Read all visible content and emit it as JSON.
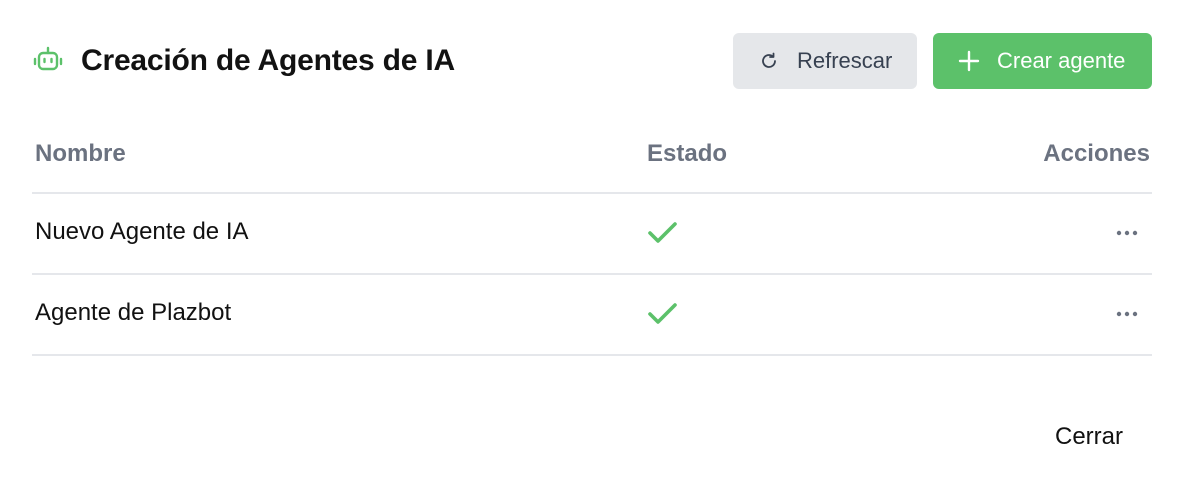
{
  "header": {
    "title": "Creación de Agentes de IA",
    "icon": "robot-icon",
    "refresh_label": "Refrescar",
    "refresh_icon": "refresh-icon",
    "create_label": "Crear agente",
    "create_icon": "plus-icon"
  },
  "table": {
    "columns": {
      "name": "Nombre",
      "state": "Estado",
      "actions": "Acciones"
    },
    "rows": [
      {
        "name": "Nuevo Agente de IA",
        "status": "active",
        "status_icon": "check-icon",
        "actions_icon": "more-icon"
      },
      {
        "name": "Agente de Plazbot",
        "status": "active",
        "status_icon": "check-icon",
        "actions_icon": "more-icon"
      }
    ]
  },
  "footer": {
    "close_label": "Cerrar"
  },
  "colors": {
    "accent_green": "#5cc16a",
    "secondary_button": "#e5e7ea",
    "header_text": "#6b7280",
    "divider": "#e5e7eb"
  }
}
